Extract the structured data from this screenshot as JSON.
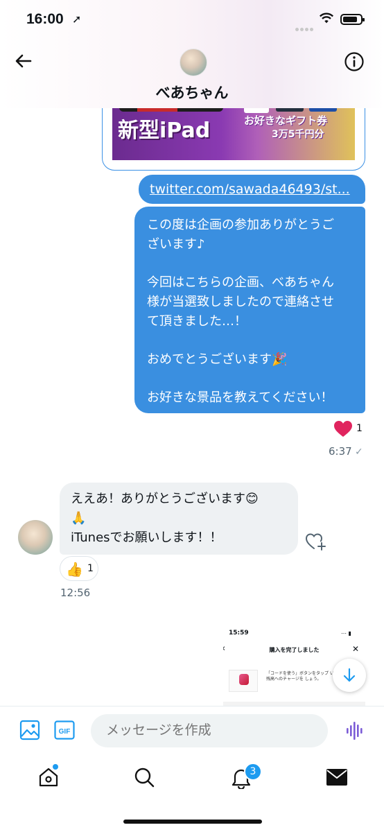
{
  "status_bar": {
    "time": "16:00",
    "location_arrow": "➚"
  },
  "header": {
    "chat_name": "べあちゃん"
  },
  "image_card": {
    "banner_title": "新型iPad",
    "gift_text": "お好きなギフト券",
    "gift_amount": "3万5千円分",
    "rakuten_label": "R\nPOINT"
  },
  "link_bubble": {
    "text": "twitter.com/sawada46493/st..."
  },
  "sent_message": {
    "lines": [
      "この度は企画の参加ありがとうご",
      "ざいます♪",
      "",
      "今回はこちらの企画、べあちゃん",
      "様が当選致しましたので連絡させ",
      "て頂きました…！",
      "",
      "おめでとうございます🎉",
      "",
      "お好きな景品を教えてください！"
    ],
    "like_count": "1",
    "time": "6:37",
    "read_mark": "✓"
  },
  "received_message": {
    "line1": "ええあ！ありがとうございます😊",
    "line2": "🙏",
    "line3": "iTunesでお願いします！！",
    "reaction_emoji": "👍",
    "reaction_count": "1",
    "time": "12:56"
  },
  "screenshot_preview": {
    "time": "15:59",
    "title": "購入を完了しました",
    "body": "「コードを使う」ボタンをタップ いのApple ID残高へのチャージを しょう。"
  },
  "composer": {
    "placeholder": "メッセージを作成",
    "gif_label": "GIF"
  },
  "tabbar": {
    "notification_badge": "3"
  },
  "colors": {
    "accent": "#1d9bf0",
    "sent_bubble": "#3a8fe0",
    "like": "#e0245e",
    "voice": "#7b5cd6"
  },
  "icons": [
    "back-arrow-icon",
    "info-icon",
    "heart-icon",
    "heart-add-icon",
    "image-icon",
    "gif-icon",
    "voice-wave-icon",
    "home-icon",
    "search-icon",
    "bell-icon",
    "mail-icon",
    "arrow-down-icon"
  ]
}
